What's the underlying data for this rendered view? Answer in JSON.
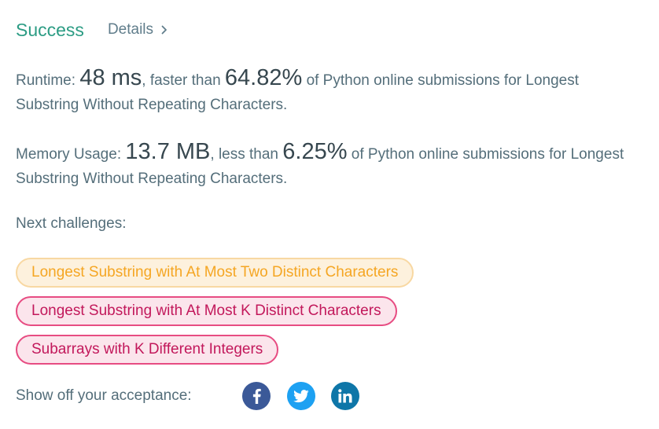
{
  "header": {
    "status": "Success",
    "details_label": "Details",
    "details_icon": "chevron-right-icon"
  },
  "runtime": {
    "label": "Runtime:",
    "value": "48 ms",
    "comparison": ", faster than",
    "percentile": "64.82%",
    "suffix": "of Python online submissions for Longest Substring Without Repeating Characters."
  },
  "memory": {
    "label": "Memory Usage:",
    "value": "13.7 MB",
    "comparison": ", less than",
    "percentile": "6.25%",
    "suffix": "of Python online submissions for Longest Substring Without Repeating Characters."
  },
  "next_challenges": {
    "label": "Next challenges:",
    "items": [
      {
        "title": "Longest Substring with At Most Two Distinct Characters",
        "difficulty_color": "#f5a623"
      },
      {
        "title": "Longest Substring with At Most K Distinct Characters",
        "difficulty_color": "#c2185b"
      },
      {
        "title": "Subarrays with K Different Integers",
        "difficulty_color": "#c2185b"
      }
    ]
  },
  "share": {
    "label": "Show off your acceptance:",
    "networks": [
      {
        "icon": "facebook-icon",
        "color": "#3b5998"
      },
      {
        "icon": "twitter-icon",
        "color": "#1da1f2"
      },
      {
        "icon": "linkedin-icon",
        "color": "#0e76a8"
      }
    ]
  }
}
